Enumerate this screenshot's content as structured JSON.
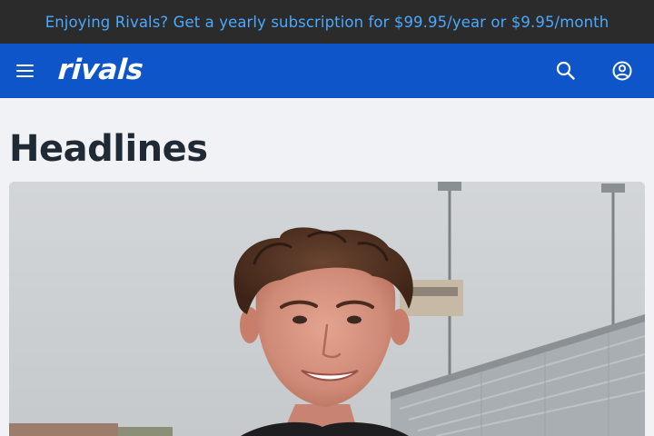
{
  "promo": {
    "text": "Enjoying Rivals? Get a yearly subscription for $99.95/year or $9.95/month"
  },
  "nav": {
    "logo": "rivals",
    "icons": {
      "menu": "hamburger-menu-icon",
      "search": "search-icon",
      "account": "account-circle-icon"
    }
  },
  "main": {
    "title": "Headlines",
    "hero_image": "player-portrait-photo"
  },
  "colors": {
    "promo_bg": "#2b2b2b",
    "promo_text": "#4aa8ff",
    "nav_bg": "#0d55c8",
    "page_bg": "#f0f2f5",
    "title": "#1f2a34"
  }
}
